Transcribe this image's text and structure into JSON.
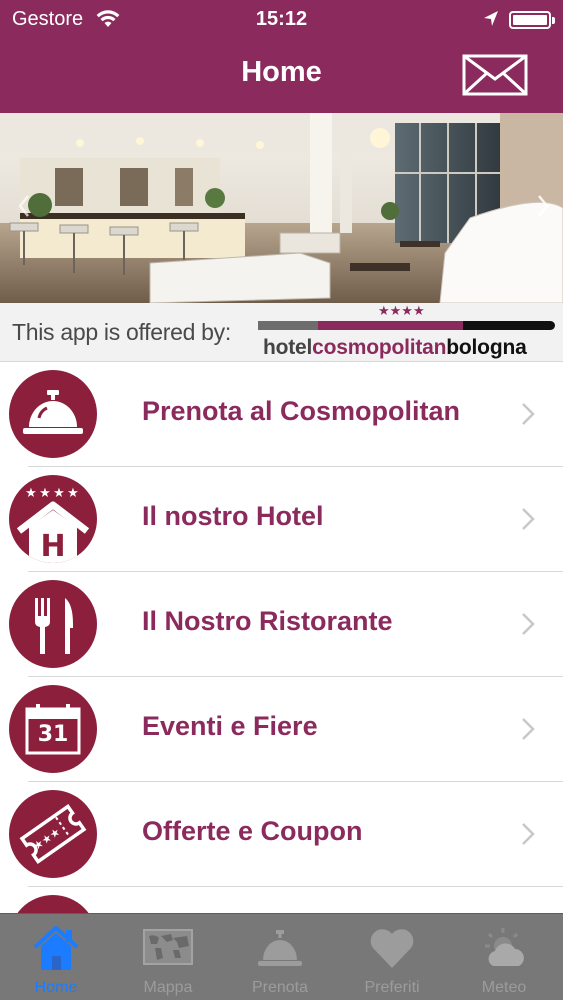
{
  "status_bar": {
    "carrier": "Gestore",
    "time": "15:12",
    "wifi_icon": "wifi-icon",
    "location_icon": "location-arrow-icon",
    "battery_icon": "battery-icon"
  },
  "nav": {
    "title": "Home",
    "mail_icon": "envelope-icon"
  },
  "hero": {
    "image": "hotel-lobby-photo",
    "prev_icon": "chevron-left-icon",
    "next_icon": "chevron-right-icon"
  },
  "sponsor": {
    "label": "This app is offered by:",
    "stars": "★★★★",
    "logo_part1": "hotel",
    "logo_part2": "cosmopolitan",
    "logo_part3": "bologna"
  },
  "menu": {
    "items": [
      {
        "label": "Prenota al Cosmopolitan",
        "icon": "reception-bell-icon"
      },
      {
        "label": "Il nostro Hotel",
        "icon": "hotel-four-stars-icon"
      },
      {
        "label": "Il Nostro Ristorante",
        "icon": "fork-knife-icon"
      },
      {
        "label": "Eventi e Fiere",
        "icon": "calendar-icon",
        "icon_text": "31"
      },
      {
        "label": "Offerte e Coupon",
        "icon": "coupon-ticket-icon"
      }
    ]
  },
  "tabs": [
    {
      "label": "Home",
      "icon": "home-icon",
      "active": true
    },
    {
      "label": "Mappa",
      "icon": "world-map-icon",
      "active": false
    },
    {
      "label": "Prenota",
      "icon": "reception-bell-icon",
      "active": false
    },
    {
      "label": "Preferiti",
      "icon": "heart-icon",
      "active": false
    },
    {
      "label": "Meteo",
      "icon": "weather-icon",
      "active": false
    }
  ],
  "colors": {
    "brand": "#8b2a5d",
    "icon_circle": "#8b1f3c",
    "tab_active": "#1b7cff",
    "tab_inactive": "#9c9c9c"
  }
}
